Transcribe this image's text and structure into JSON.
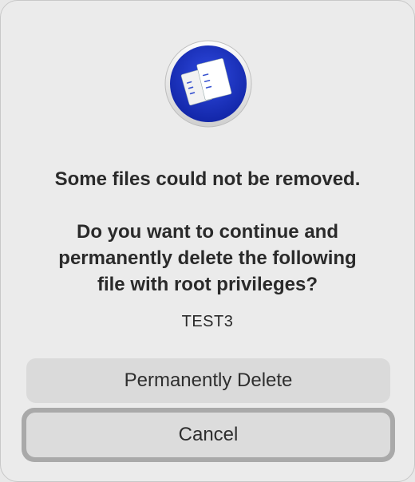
{
  "dialog": {
    "icon": "app-icon",
    "title": "Some files could not be removed.",
    "question_lines": [
      "Do you want to continue and",
      "permanently delete the following",
      "file with root privileges?"
    ],
    "filename": "TEST3"
  },
  "buttons": {
    "delete_label": "Permanently Delete",
    "cancel_label": "Cancel"
  },
  "colors": {
    "icon_blue": "#1a2fc0",
    "focus_ring": "#a9a9a9"
  }
}
